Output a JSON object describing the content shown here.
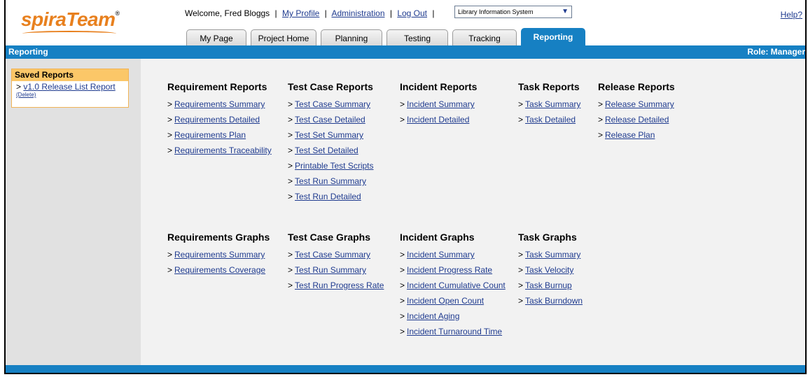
{
  "logo": {
    "text": "spiraTeam",
    "reg": "®"
  },
  "userbar": {
    "welcome": "Welcome, Fred Bloggs",
    "my_profile": "My Profile",
    "administration": "Administration",
    "logout": "Log Out",
    "separator": "|"
  },
  "project_select": {
    "value": "Library Information System"
  },
  "help": "Help?",
  "tabs": [
    {
      "label": "My Page"
    },
    {
      "label": "Project Home"
    },
    {
      "label": "Planning"
    },
    {
      "label": "Testing"
    },
    {
      "label": "Tracking"
    },
    {
      "label": "Reporting"
    }
  ],
  "section_bar": {
    "title": "Reporting",
    "role": "Role: Manager"
  },
  "saved_reports": {
    "title": "Saved Reports",
    "item": "v1.0 Release List Report",
    "item_prefix": ">",
    "delete": "(Delete)"
  },
  "link_prefix": ">",
  "report_groups": [
    {
      "title": "Requirement Reports",
      "links": [
        "Requirements Summary",
        "Requirements Detailed",
        "Requirements Plan",
        "Requirements Traceability"
      ]
    },
    {
      "title": "Test Case Reports",
      "links": [
        "Test Case Summary",
        "Test Case Detailed",
        "Test Set Summary",
        "Test Set Detailed",
        "Printable Test Scripts",
        "Test Run Summary",
        "Test Run Detailed"
      ]
    },
    {
      "title": "Incident Reports",
      "links": [
        "Incident Summary",
        "Incident Detailed"
      ]
    },
    {
      "title": "Task Reports",
      "links": [
        "Task Summary",
        "Task Detailed"
      ]
    },
    {
      "title": "Release Reports",
      "links": [
        "Release Summary",
        "Release Detailed",
        "Release Plan"
      ]
    }
  ],
  "graph_groups": [
    {
      "title": "Requirements Graphs",
      "links": [
        "Requirements Summary",
        "Requirements Coverage"
      ]
    },
    {
      "title": "Test Case Graphs",
      "links": [
        "Test Case Summary",
        "Test Run Summary",
        "Test Run Progress Rate"
      ]
    },
    {
      "title": "Incident Graphs",
      "links": [
        "Incident Summary",
        "Incident Progress Rate",
        "Incident Cumulative Count",
        "Incident Open Count",
        "Incident Aging",
        "Incident Turnaround Time"
      ]
    },
    {
      "title": "Task Graphs",
      "links": [
        "Task Summary",
        "Task Velocity",
        "Task Burnup",
        "Task Burndown"
      ]
    }
  ],
  "colors": {
    "brand_orange": "#e8801e",
    "header_blue": "#1680c3",
    "saved_header": "#fbc768",
    "link": "#1f3b8f"
  }
}
